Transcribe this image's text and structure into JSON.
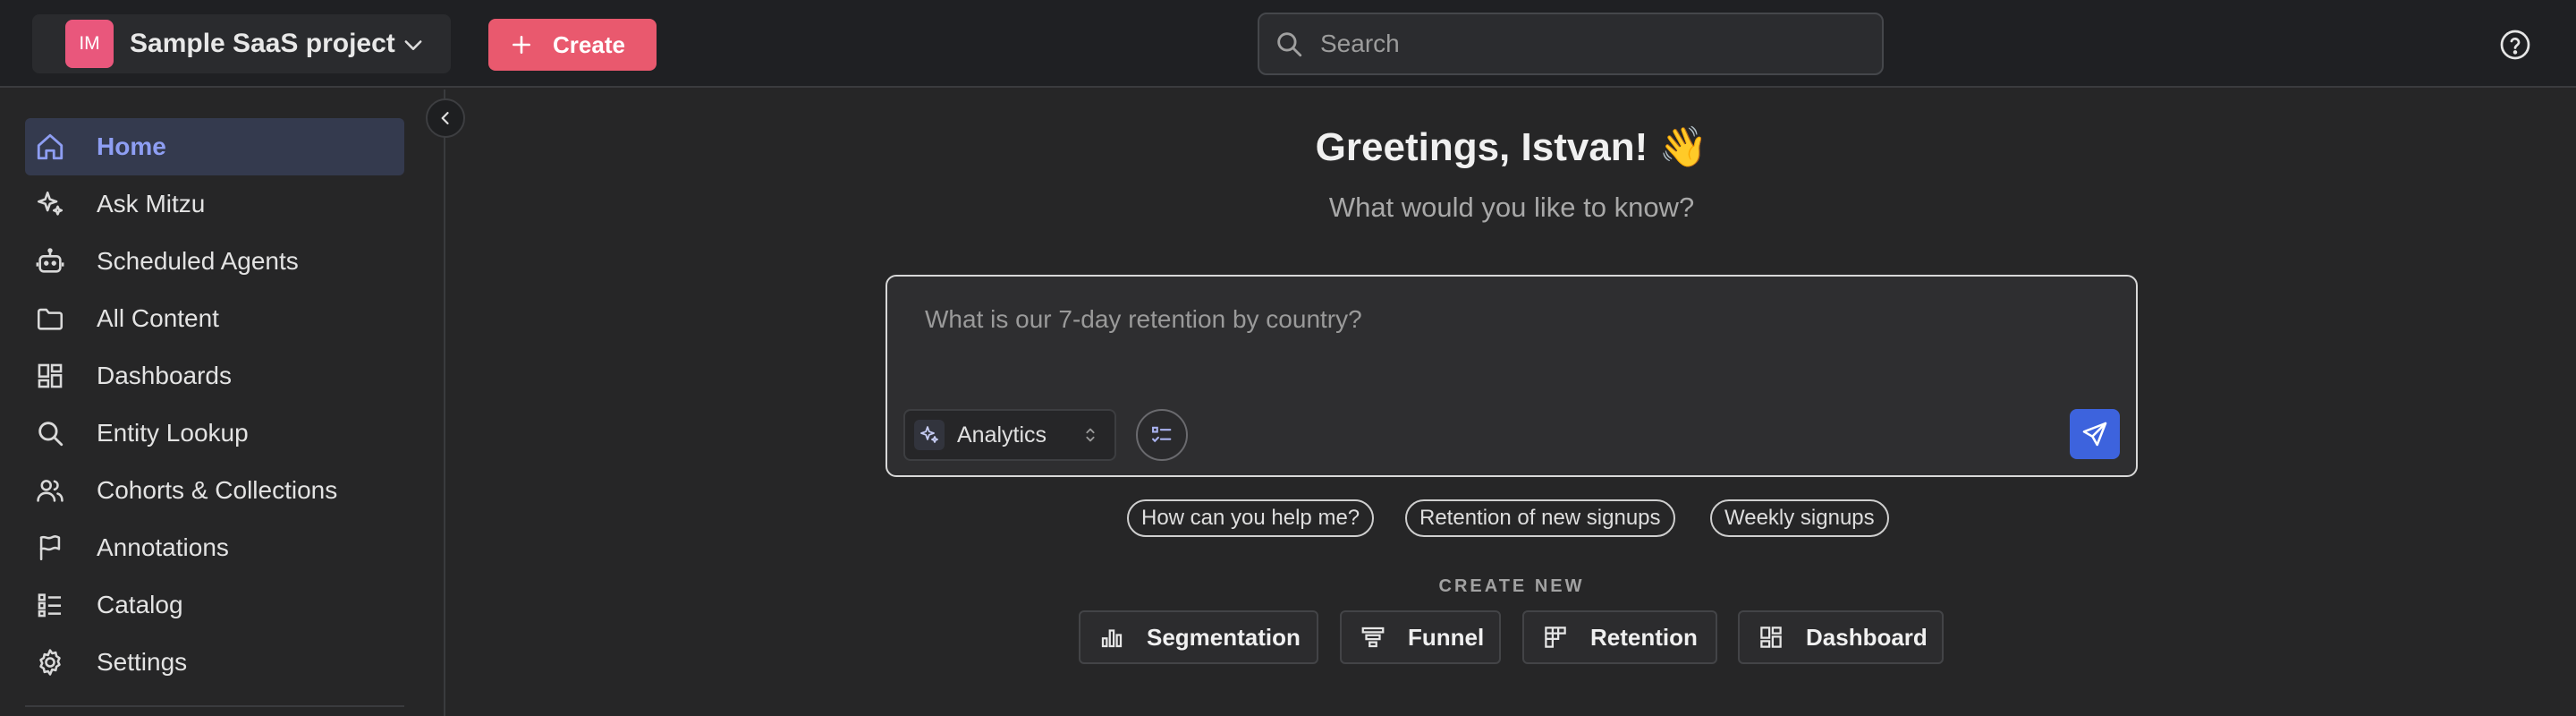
{
  "header": {
    "project_initials": "IM",
    "project_name": "Sample SaaS project",
    "create_label": "Create",
    "search_placeholder": "Search"
  },
  "sidebar": {
    "items": [
      {
        "label": "Home",
        "icon": "home-icon",
        "active": true
      },
      {
        "label": "Ask Mitzu",
        "icon": "sparkle-icon"
      },
      {
        "label": "Scheduled Agents",
        "icon": "robot-icon"
      },
      {
        "label": "All Content",
        "icon": "folder-icon"
      },
      {
        "label": "Dashboards",
        "icon": "dashboard-grid-icon"
      },
      {
        "label": "Entity Lookup",
        "icon": "search-icon"
      },
      {
        "label": "Cohorts & Collections",
        "icon": "users-icon"
      },
      {
        "label": "Annotations",
        "icon": "flag-icon"
      },
      {
        "label": "Catalog",
        "icon": "list-icon"
      },
      {
        "label": "Settings",
        "icon": "gear-icon"
      }
    ]
  },
  "main": {
    "greeting": "Greetings, Istvan! 👋",
    "subtitle": "What would you like to know?",
    "ask": {
      "placeholder": "What is our 7-day retention by country?",
      "mode": "Analytics"
    },
    "suggestions": [
      "How can you help me?",
      "Retention of new signups",
      "Weekly signups"
    ],
    "create_new": {
      "label": "CREATE NEW",
      "buttons": [
        "Segmentation",
        "Funnel",
        "Retention",
        "Dashboard"
      ]
    }
  },
  "colors": {
    "accent": "#e9596e",
    "active_nav": "#8e9ef3",
    "send_button": "#3d63dd",
    "avatar": "#e9577c"
  }
}
